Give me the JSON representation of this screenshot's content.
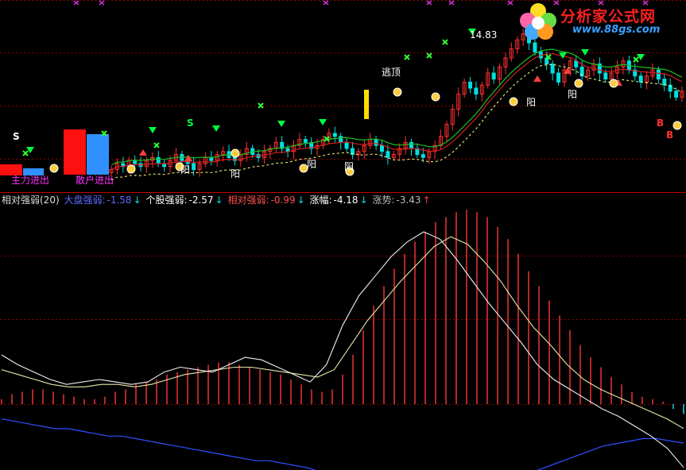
{
  "logo": {
    "name": "分析家公式网",
    "url": "www.88gs.com"
  },
  "upper_panel": {
    "price_label": "14.83",
    "labels": {
      "main_force": "主力进出",
      "retail": "散户进出",
      "top_escape": "逃顶",
      "yang": "阳",
      "signal_s": "S",
      "signal_b": "B"
    }
  },
  "legend": {
    "title": "相对强弱(20)",
    "market": {
      "label": "大盘强弱:",
      "value": "-1.58",
      "arrow": "↓",
      "color": "#5a6cff"
    },
    "stock": {
      "label": "个股强弱:",
      "value": "-2.57",
      "arrow": "↓",
      "color": "#ffffff"
    },
    "relative": {
      "label": "相对强弱:",
      "value": "-0.99",
      "arrow": "↓",
      "color": "#ff5050"
    },
    "change": {
      "label": "涨幅:",
      "value": "-4.18",
      "arrow": "↓",
      "color": "#ffffff"
    },
    "trend": {
      "label": "涨势:",
      "value": "-3.43",
      "arrow": "↑",
      "color": "#bbbbbb"
    }
  },
  "colors": {
    "up": "#ff3030",
    "down": "#00e0e0",
    "ma_red": "#d02020",
    "ma_green": "#20c020",
    "dashed": "#ffff80",
    "bar_red": "#e03030",
    "blue_line": "#3050ff",
    "grid": "#8a0000"
  },
  "chart_data": [
    {
      "type": "candlestick",
      "title": "",
      "closes": [
        10.3,
        10.5,
        10.4,
        10.6,
        10.5,
        10.4,
        10.6,
        10.7,
        10.5,
        10.4,
        10.6,
        10.8,
        10.6,
        10.5,
        10.3,
        10.5,
        10.7,
        10.6,
        10.8,
        10.9,
        10.7,
        10.6,
        10.8,
        11.0,
        10.8,
        10.7,
        10.9,
        11.0,
        11.2,
        11.0,
        10.9,
        11.1,
        11.3,
        11.2,
        11.0,
        11.1,
        11.3,
        11.5,
        11.4,
        11.2,
        11.0,
        10.8,
        10.9,
        11.1,
        11.3,
        11.1,
        10.9,
        10.7,
        10.8,
        11.0,
        11.2,
        11.0,
        10.8,
        10.7,
        10.9,
        11.1,
        11.4,
        11.8,
        12.3,
        12.8,
        13.2,
        13.0,
        12.8,
        13.1,
        13.5,
        13.3,
        13.7,
        14.0,
        14.3,
        14.6,
        14.8,
        14.5,
        14.2,
        14.0,
        13.8,
        13.5,
        13.2,
        13.6,
        13.9,
        13.7,
        13.4,
        13.6,
        13.8,
        13.5,
        13.3,
        13.5,
        13.7,
        13.9,
        13.6,
        13.4,
        13.2,
        13.4,
        13.6,
        13.3,
        13.1,
        12.9,
        12.7,
        12.9
      ],
      "high_marker": 14.83
    },
    {
      "type": "bar",
      "title": "相对强弱(20)",
      "values": [
        0.2,
        0.4,
        0.5,
        0.6,
        0.6,
        0.5,
        0.4,
        0.3,
        0.2,
        0.2,
        0.3,
        0.5,
        0.6,
        0.8,
        0.9,
        1.0,
        1.2,
        1.3,
        1.4,
        1.5,
        1.6,
        1.7,
        1.7,
        1.6,
        1.5,
        1.4,
        1.3,
        1.2,
        1.0,
        0.8,
        0.6,
        0.5,
        0.6,
        1.2,
        2.0,
        3.0,
        4.0,
        4.8,
        5.5,
        6.1,
        6.6,
        7.0,
        7.4,
        7.6,
        7.8,
        7.9,
        7.8,
        7.6,
        7.2,
        6.7,
        6.1,
        5.4,
        4.8,
        4.2,
        3.6,
        3.0,
        2.4,
        1.9,
        1.5,
        1.1,
        0.8,
        0.5,
        0.3,
        0.2,
        0.1,
        -0.2,
        -0.4
      ],
      "lines": {
        "market": [
          -0.6,
          -0.7,
          -0.8,
          -0.9,
          -1.0,
          -1.0,
          -1.1,
          -1.2,
          -1.3,
          -1.3,
          -1.4,
          -1.5,
          -1.6,
          -1.7,
          -1.8,
          -1.9,
          -2.0,
          -2.1,
          -2.2,
          -2.3,
          -2.3,
          -2.4,
          -2.5,
          -2.6,
          -2.8,
          -2.9,
          -3.0,
          -3.1,
          -3.2,
          -3.3,
          -3.4,
          -3.5,
          -3.6,
          -3.6,
          -3.6,
          -3.5,
          -3.4,
          -3.3,
          -3.1,
          -2.9,
          -2.7,
          -2.5,
          -2.3,
          -2.1,
          -1.9,
          -1.7,
          -1.6,
          -1.5,
          -1.4,
          -1.4,
          -1.5,
          -1.58
        ],
        "stock": [
          2.0,
          1.6,
          1.3,
          1.0,
          0.8,
          0.9,
          1.0,
          0.9,
          0.8,
          0.9,
          1.3,
          1.5,
          1.4,
          1.3,
          1.6,
          1.9,
          1.8,
          1.5,
          1.2,
          0.9,
          1.6,
          3.2,
          4.4,
          5.2,
          6.0,
          6.6,
          7.0,
          6.7,
          5.9,
          5.0,
          4.1,
          3.3,
          2.5,
          1.6,
          1.0,
          0.6,
          0.2,
          -0.2,
          -0.5,
          -0.9,
          -1.3,
          -1.8,
          -2.57
        ],
        "relative": [
          1.4,
          1.2,
          1.0,
          0.8,
          0.7,
          0.7,
          0.8,
          0.8,
          0.7,
          0.8,
          1.0,
          1.2,
          1.3,
          1.4,
          1.5,
          1.5,
          1.4,
          1.3,
          1.2,
          1.1,
          1.4,
          2.4,
          3.4,
          4.2,
          5.0,
          5.7,
          6.4,
          6.8,
          6.5,
          5.8,
          5.0,
          4.0,
          3.1,
          2.4,
          1.6,
          1.0,
          0.6,
          0.3,
          0.0,
          -0.3,
          -0.6,
          -0.99
        ]
      }
    }
  ]
}
